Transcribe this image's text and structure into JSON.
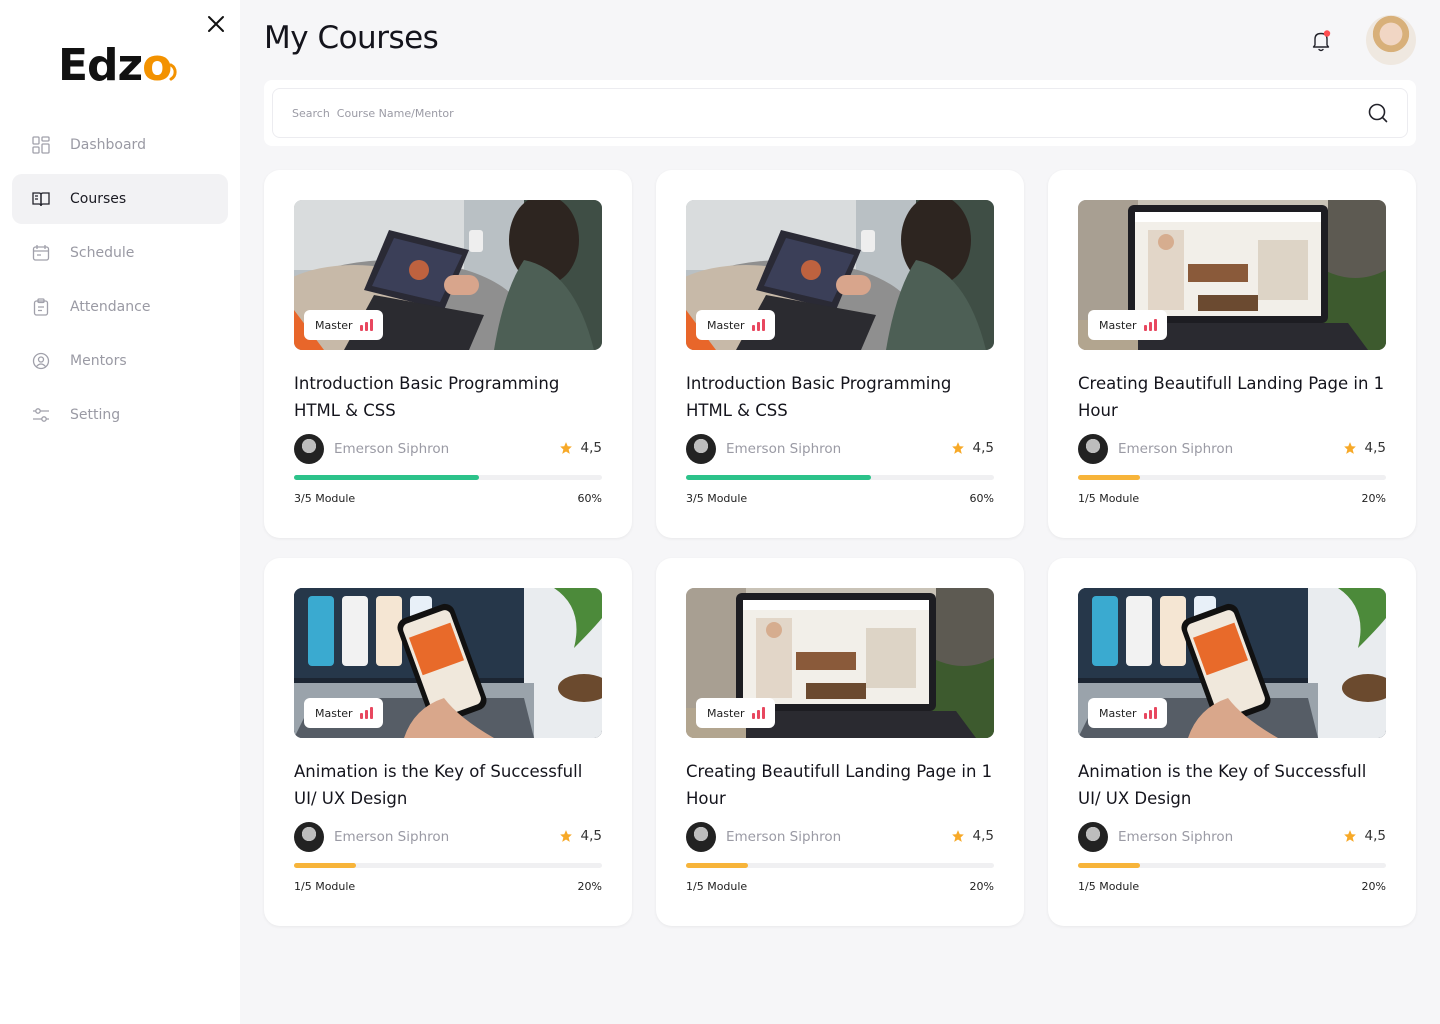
{
  "brand": {
    "name_main": "Edz",
    "name_o": "o"
  },
  "sidebar": {
    "items": [
      {
        "label": "Dashboard",
        "icon": "dashboard-icon"
      },
      {
        "label": "Courses",
        "icon": "book-icon",
        "active": true
      },
      {
        "label": "Schedule",
        "icon": "calendar-icon"
      },
      {
        "label": "Attendance",
        "icon": "clipboard-icon"
      },
      {
        "label": "Mentors",
        "icon": "user-icon"
      },
      {
        "label": "Setting",
        "icon": "sliders-icon"
      }
    ]
  },
  "header": {
    "title": "My Courses",
    "notification_dot_color": "#ff4d4f"
  },
  "search": {
    "placeholder": "Search  Course Name/Mentor"
  },
  "colors": {
    "green": "#2cc28a",
    "orange": "#f7b43a",
    "star": "#f7a928",
    "badge_bars": "#e8475f"
  },
  "courses": [
    {
      "title": "Introduction Basic Programming HTML & CSS",
      "level": "Master",
      "mentor": "Emerson Siphron",
      "rating": "4,5",
      "modules": "3/5 Module",
      "percent": "60%",
      "progress": 0.6,
      "image": "tablet-drawing"
    },
    {
      "title": "Introduction Basic Programming HTML & CSS",
      "level": "Master",
      "mentor": "Emerson Siphron",
      "rating": "4,5",
      "modules": "3/5 Module",
      "percent": "60%",
      "progress": 0.6,
      "image": "tablet-drawing"
    },
    {
      "title": "Creating Beautifull Landing Page in 1 Hour",
      "level": "Master",
      "mentor": "Emerson Siphron",
      "rating": "4,5",
      "modules": "1/5 Module",
      "percent": "20%",
      "progress": 0.2,
      "image": "laptop-landing"
    },
    {
      "title": "Animation is the Key of Successfull UI/ UX Design",
      "level": "Master",
      "mentor": "Emerson Siphron",
      "rating": "4,5",
      "modules": "1/5 Module",
      "percent": "20%",
      "progress": 0.2,
      "image": "phone-app"
    },
    {
      "title": "Creating Beautifull Landing Page in 1 Hour",
      "level": "Master",
      "mentor": "Emerson Siphron",
      "rating": "4,5",
      "modules": "1/5 Module",
      "percent": "20%",
      "progress": 0.2,
      "image": "laptop-landing"
    },
    {
      "title": "Animation is the Key of Successfull UI/ UX Design",
      "level": "Master",
      "mentor": "Emerson Siphron",
      "rating": "4,5",
      "modules": "1/5 Module",
      "percent": "20%",
      "progress": 0.2,
      "image": "phone-app"
    }
  ]
}
